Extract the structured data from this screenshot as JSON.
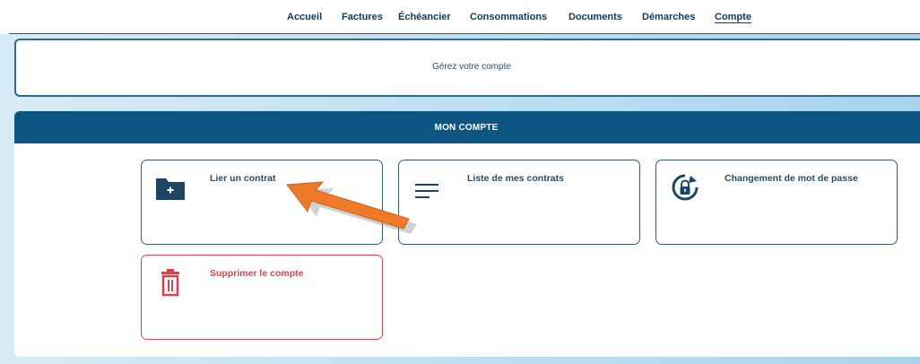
{
  "nav": {
    "items": [
      {
        "label": "Accueil",
        "active": false
      },
      {
        "label": "Factures",
        "active": false
      },
      {
        "label": "Échéancier",
        "active": false
      },
      {
        "label": "Consommations",
        "active": false
      },
      {
        "label": "Documents",
        "active": false
      },
      {
        "label": "Démarches",
        "active": false
      },
      {
        "label": "Compte",
        "active": true
      }
    ]
  },
  "intro": {
    "text": "Gérez votre compte"
  },
  "panel": {
    "title": "MON COMPTE",
    "cards": [
      {
        "label": "Lier un contrat",
        "icon": "folder-plus-icon"
      },
      {
        "label": "Liste de mes contrats",
        "icon": "list-icon"
      },
      {
        "label": "Changement de mot de passe",
        "icon": "lock-refresh-icon"
      },
      {
        "label": "Supprimer le compte",
        "icon": "trash-icon"
      }
    ]
  },
  "colors": {
    "primary": "#0d5684",
    "text_dark": "#0e3a5c",
    "danger": "#e0404a",
    "annotation_arrow": "#f07a2a"
  }
}
